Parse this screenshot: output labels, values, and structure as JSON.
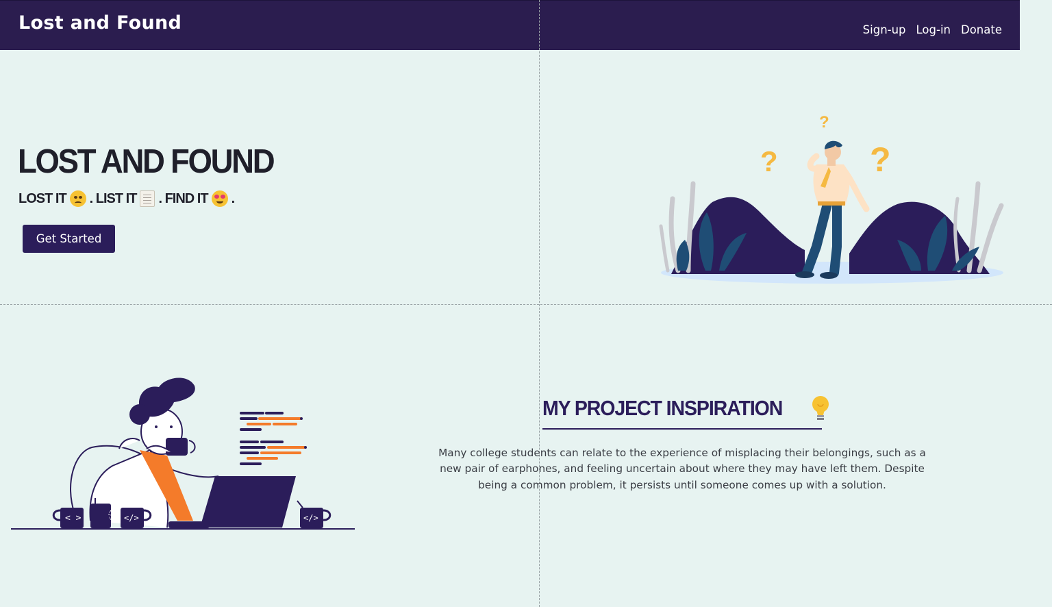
{
  "navbar": {
    "brand": "Lost and Found",
    "links": [
      "Sign-up",
      "Log-in",
      "Donate"
    ]
  },
  "hero": {
    "title": "LOST AND FOUND",
    "tagline": {
      "part1": "LOST IT",
      "part2": ". LIST IT",
      "part3": ". FIND IT",
      "part4": "."
    },
    "cta_label": "Get Started"
  },
  "inspiration": {
    "title": "MY PROJECT INSPIRATION",
    "body": "Many college students can relate to the experience of misplacing their belongings, such as a new pair of earphones, and feeling uncertain about where they may have left them. Despite being a common problem, it persists until someone comes up with a solution."
  },
  "icons": [
    "confused-face-icon",
    "scroll-icon",
    "star-struck-face-icon",
    "lightbulb-icon"
  ],
  "colors": {
    "navbar_bg": "#2b1d4f",
    "page_bg": "#e7f3f1",
    "accent_purple": "#2b1d5a",
    "accent_orange": "#f47b2a",
    "accent_yellow": "#f5b942"
  }
}
